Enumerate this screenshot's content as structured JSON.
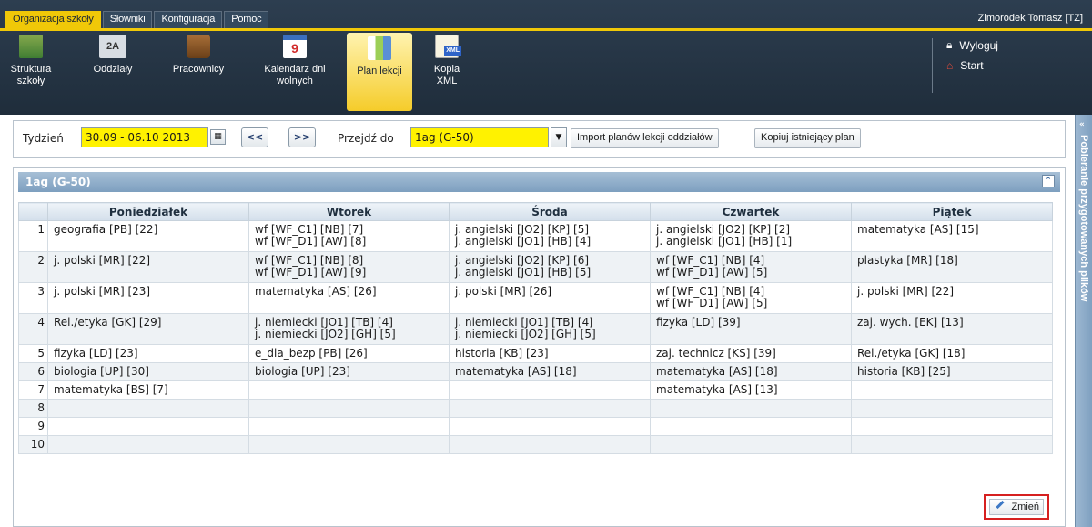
{
  "menu": {
    "tabs": [
      {
        "label": "Organizacja szkoły"
      },
      {
        "label": "Słowniki"
      },
      {
        "label": "Konfiguracja"
      },
      {
        "label": "Pomoc"
      }
    ],
    "user": "Zimorodek Tomasz [TZ]"
  },
  "toolbar": {
    "struktura": "Struktura szkoły",
    "oddzialy": "Oddziały",
    "oddzialy_icon_text": "2A",
    "pracownicy": "Pracownicy",
    "kalendarz": "Kalendarz dni wolnych",
    "kalendarz_icon_text": "9",
    "plan": "Plan lekcji",
    "kopia": "Kopia XML",
    "kopia_icon_text": "XML"
  },
  "links": {
    "logout": "Wyloguj",
    "start": "Start"
  },
  "weekbar": {
    "week_label": "Tydzień",
    "week_value": "30.09 - 06.10 2013",
    "prev": "<<",
    "next": ">>",
    "goto_label": "Przejdź do",
    "goto_value": "1ag (G-50)",
    "import_button": "Import planów lekcji oddziałów",
    "copy_button": "Kopiuj istniejący plan"
  },
  "panel": {
    "title": "1ag (G-50)",
    "change_button": "Zmień"
  },
  "side_tab": {
    "label": "Pobieranie przygotowanych plików"
  },
  "timetable": {
    "days": [
      "Poniedziałek",
      "Wtorek",
      "Środa",
      "Czwartek",
      "Piątek"
    ],
    "rows": [
      {
        "n": "1",
        "cells": [
          [
            "geografia [PB] [22]"
          ],
          [
            "wf [WF_C1] [NB] [7]",
            "wf [WF_D1] [AW] [8]"
          ],
          [
            "j. angielski [JO2] [KP] [5]",
            "j. angielski [JO1] [HB] [4]"
          ],
          [
            "j. angielski [JO2] [KP] [2]",
            "j. angielski [JO1] [HB] [1]"
          ],
          [
            "matematyka [AS] [15]"
          ]
        ]
      },
      {
        "n": "2",
        "cells": [
          [
            "j. polski [MR] [22]"
          ],
          [
            "wf [WF_C1] [NB] [8]",
            "wf [WF_D1] [AW] [9]"
          ],
          [
            "j. angielski [JO2] [KP] [6]",
            "j. angielski [JO1] [HB] [5]"
          ],
          [
            "wf [WF_C1] [NB] [4]",
            "wf [WF_D1] [AW] [5]"
          ],
          [
            "plastyka [MR] [18]"
          ]
        ]
      },
      {
        "n": "3",
        "cells": [
          [
            "j. polski [MR] [23]"
          ],
          [
            "matematyka [AS] [26]"
          ],
          [
            "j. polski [MR] [26]"
          ],
          [
            "wf [WF_C1] [NB] [4]",
            "wf [WF_D1] [AW] [5]"
          ],
          [
            "j. polski [MR] [22]"
          ]
        ]
      },
      {
        "n": "4",
        "cells": [
          [
            "Rel./etyka [GK] [29]"
          ],
          [
            "j. niemiecki [JO1] [TB] [4]",
            "j. niemiecki [JO2] [GH] [5]"
          ],
          [
            "j. niemiecki [JO1] [TB] [4]",
            "j. niemiecki [JO2] [GH] [5]"
          ],
          [
            "fizyka [LD] [39]"
          ],
          [
            "zaj. wych. [EK] [13]"
          ]
        ]
      },
      {
        "n": "5",
        "cells": [
          [
            "fizyka [LD] [23]"
          ],
          [
            "e_dla_bezp [PB] [26]"
          ],
          [
            "historia [KB] [23]"
          ],
          [
            "zaj. technicz [KS] [39]"
          ],
          [
            "Rel./etyka [GK] [18]"
          ]
        ]
      },
      {
        "n": "6",
        "cells": [
          [
            "biologia [UP] [30]"
          ],
          [
            "biologia [UP] [23]"
          ],
          [
            "matematyka [AS] [18]"
          ],
          [
            "matematyka [AS] [18]"
          ],
          [
            "historia [KB] [25]"
          ]
        ]
      },
      {
        "n": "7",
        "cells": [
          [
            "matematyka [BS] [7]"
          ],
          [],
          [],
          [
            "matematyka [AS] [13]"
          ],
          []
        ]
      },
      {
        "n": "8",
        "cells": [
          [],
          [],
          [],
          [],
          []
        ]
      },
      {
        "n": "9",
        "cells": [
          [],
          [],
          [],
          [],
          []
        ]
      },
      {
        "n": "10",
        "cells": [
          [],
          [],
          [],
          [],
          []
        ]
      }
    ]
  }
}
